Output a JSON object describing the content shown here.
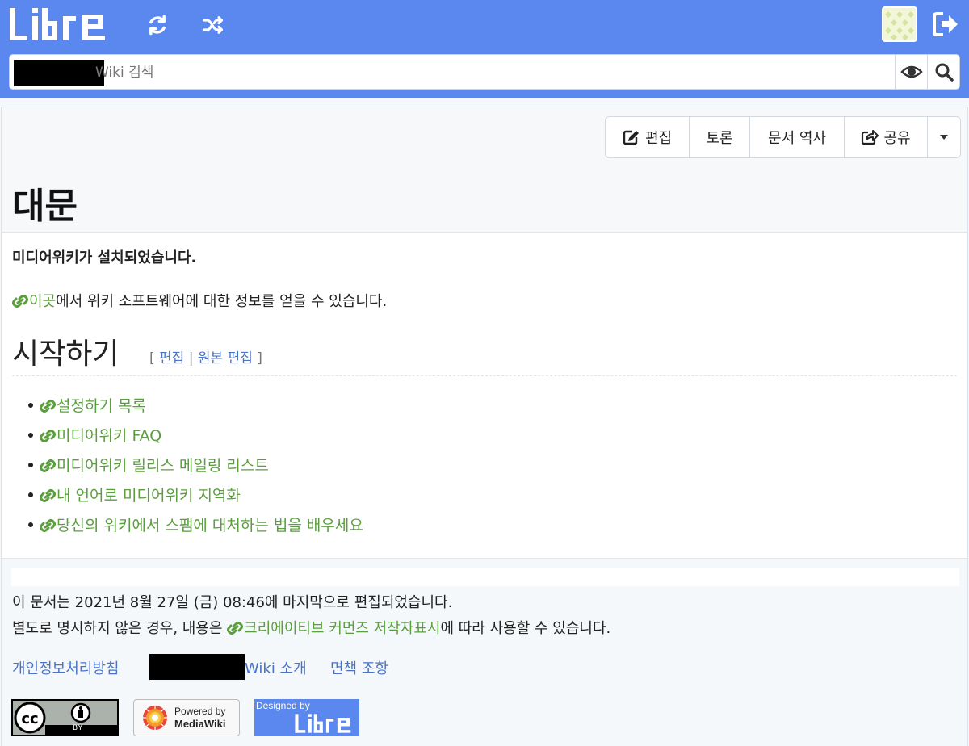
{
  "header": {
    "search_placeholder": "Wiki 검색"
  },
  "actions": {
    "edit": "편집",
    "discussion": "토론",
    "history": "문서 역사",
    "share": "공유"
  },
  "page": {
    "title": "대문",
    "installed": "미디어위키가 설치되었습니다.",
    "info_link": "이곳",
    "info_rest": "에서 위키 소프트웨어에 대한 정보를 얻을 수 있습니다.",
    "section_title": "시작하기",
    "section_edit_open": "[ ",
    "section_edit": "편집",
    "section_sep": " | ",
    "section_source_edit": "원본 편집",
    "section_edit_close": " ]",
    "links": [
      "설정하기 목록",
      "미디어위키 FAQ",
      "미디어위키 릴리스 메일링 리스트",
      "내 언어로 미디어위키 지역화",
      "당신의 위키에서 스팸에 대처하는 법을 배우세요"
    ]
  },
  "footer": {
    "last_edited": "이 문서는 2021년 8월 27일 (금) 08:46에 마지막으로 편집되었습니다.",
    "license_prefix": "별도로 명시하지 않은 경우, 내용은 ",
    "license_link": "크리에이티브 커먼즈 저작자표시",
    "license_suffix": "에 따라 사용할 수 있습니다.",
    "privacy": "개인정보처리방침",
    "about": "Wiki 소개",
    "disclaimer": "면책 조항",
    "badge_cc": "BY",
    "badge_mw_line1": "Powered by",
    "badge_mw_line2": "MediaWiki",
    "badge_libre": "Designed by"
  },
  "colors": {
    "header_bg": "#5b88ef",
    "link_green": "#5a9e3d",
    "link_blue": "#4a73c6"
  }
}
